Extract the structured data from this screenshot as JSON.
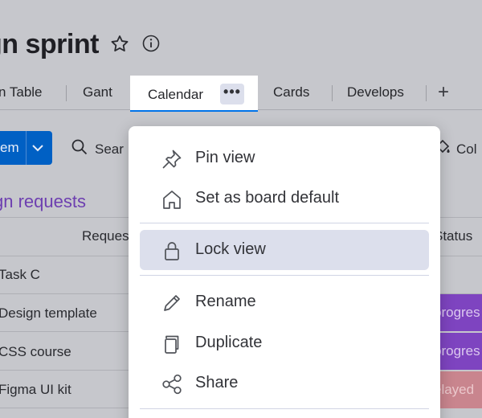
{
  "board": {
    "title": "gn sprint",
    "tabs": [
      {
        "label": "n Table"
      },
      {
        "label": "Gant"
      },
      {
        "label": "Calendar",
        "active": true
      },
      {
        "label": "Cards"
      },
      {
        "label": "Develops"
      }
    ],
    "add_tab": "+",
    "more_glyph": "•••",
    "new_item_label": "em",
    "search_label": "Sear",
    "column_tool_label": "Col",
    "group_title": "gn requests",
    "columns": {
      "request": "Reques",
      "status": "Status"
    },
    "rows": [
      {
        "name": "Task C",
        "status": ""
      },
      {
        "name": "Design template",
        "status": "progres"
      },
      {
        "name": "CSS course",
        "status": "progres"
      },
      {
        "name": "Figma UI kit",
        "status": "elayed"
      }
    ],
    "colors": {
      "accent": "#0073ea",
      "group": "#6d3fb0",
      "status_progress": "#7e44c0",
      "status_delayed": "#c9858e"
    }
  },
  "menu": {
    "items": [
      {
        "label": "Pin view",
        "icon": "pin-icon"
      },
      {
        "label": "Set as board default",
        "icon": "home-icon"
      },
      {
        "label": "Lock view",
        "icon": "lock-icon",
        "highlighted": true
      },
      {
        "label": "Rename",
        "icon": "pencil-icon"
      },
      {
        "label": "Duplicate",
        "icon": "duplicate-icon"
      },
      {
        "label": "Share",
        "icon": "share-icon"
      }
    ]
  }
}
